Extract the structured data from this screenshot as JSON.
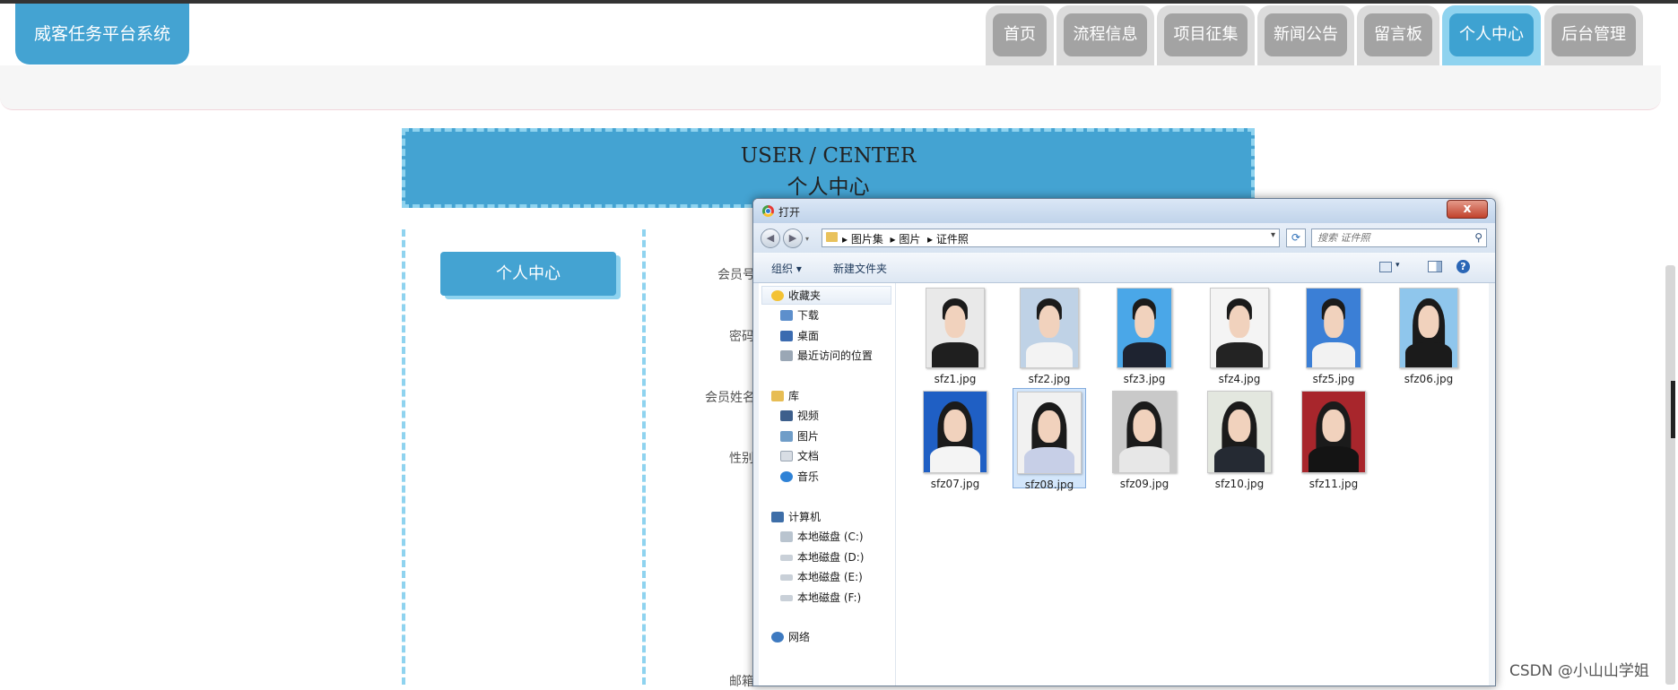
{
  "site": {
    "logo": "威客任务平台系统"
  },
  "nav": [
    {
      "label": "首页",
      "active": false
    },
    {
      "label": "流程信息",
      "active": false
    },
    {
      "label": "项目征集",
      "active": false
    },
    {
      "label": "新闻公告",
      "active": false
    },
    {
      "label": "留言板",
      "active": false
    },
    {
      "label": "个人中心",
      "active": true
    },
    {
      "label": "后台管理",
      "active": false
    }
  ],
  "banner": {
    "en": "USER / CENTER",
    "zh": "个人中心"
  },
  "sidebar": {
    "button": "个人中心"
  },
  "form_labels": [
    "会员号",
    "密码",
    "会员姓名",
    "性别",
    "邮箱"
  ],
  "dialog": {
    "title": "打开",
    "close": "x",
    "address": {
      "path": [
        "图片集",
        "图片",
        "证件照"
      ]
    },
    "search": {
      "placeholder": "搜索 证件照"
    },
    "toolbar": {
      "organize": "组织 ▾",
      "new_folder": "新建文件夹"
    },
    "nav": {
      "favorites": "收藏夹",
      "downloads": "下载",
      "desktop": "桌面",
      "recent": "最近访问的位置",
      "libraries": "库",
      "videos": "视频",
      "pictures": "图片",
      "documents": "文档",
      "music": "音乐",
      "computer": "计算机",
      "disk_c": "本地磁盘 (C:)",
      "disk_d": "本地磁盘 (D:)",
      "disk_e": "本地磁盘 (E:)",
      "disk_f": "本地磁盘 (F:)",
      "network": "网络"
    },
    "files": [
      {
        "name": "sfz1.jpg",
        "bg": "#e9e9e9",
        "body": "#1f1f1f",
        "hair": "short",
        "selected": false
      },
      {
        "name": "sfz2.jpg",
        "bg": "#bfd2e6",
        "body": "#f3f3f3",
        "hair": "short",
        "selected": false
      },
      {
        "name": "sfz3.jpg",
        "bg": "#4aa7e8",
        "body": "#1e2330",
        "hair": "short",
        "selected": false
      },
      {
        "name": "sfz4.jpg",
        "bg": "#f4f4f4",
        "body": "#232323",
        "hair": "short",
        "selected": false
      },
      {
        "name": "sfz5.jpg",
        "bg": "#3b7fd6",
        "body": "#f2f2f2",
        "hair": "short",
        "selected": false
      },
      {
        "name": "sfz06.jpg",
        "bg": "#8fc6ec",
        "body": "#1b1b1b",
        "hair": "long",
        "selected": false
      },
      {
        "name": "sfz07.jpg",
        "bg": "#1f5fc4",
        "body": "#f4f4f4",
        "hair": "long",
        "selected": false
      },
      {
        "name": "sfz08.jpg",
        "bg": "#f1f1f1",
        "body": "#c7cfe7",
        "hair": "long",
        "selected": true
      },
      {
        "name": "sfz09.jpg",
        "bg": "#c9c9c9",
        "body": "#e7e7e7",
        "hair": "long",
        "selected": false
      },
      {
        "name": "sfz10.jpg",
        "bg": "#e3e7df",
        "body": "#252a33",
        "hair": "long",
        "selected": false
      },
      {
        "name": "sfz11.jpg",
        "bg": "#a8262c",
        "body": "#141414",
        "hair": "long",
        "selected": false
      }
    ]
  },
  "watermark": "CSDN @小山山学姐"
}
